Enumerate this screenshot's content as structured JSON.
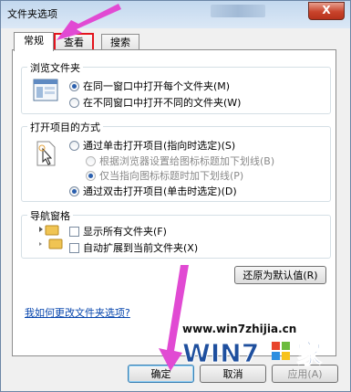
{
  "window": {
    "title": "文件夹选项",
    "close_label": "X"
  },
  "tabs": [
    {
      "label": "常规"
    },
    {
      "label": "查看"
    },
    {
      "label": "搜索"
    }
  ],
  "browse_group": {
    "title": "浏览文件夹",
    "options": [
      {
        "label": "在同一窗口中打开每个文件夹(M)",
        "selected": true
      },
      {
        "label": "在不同窗口中打开不同的文件夹(W)",
        "selected": false
      }
    ]
  },
  "click_group": {
    "title": "打开项目的方式",
    "options": [
      {
        "label": "通过单击打开项目(指向时选定)(S)",
        "selected": false
      },
      {
        "label": "根据浏览器设置给图标标题加下划线(B)",
        "selected": false,
        "disabled": true
      },
      {
        "label": "仅当指向图标标题时加下划线(P)",
        "selected": true,
        "disabled": true
      },
      {
        "label": "通过双击打开项目(单击时选定)(D)",
        "selected": true
      }
    ]
  },
  "nav_group": {
    "title": "导航窗格",
    "options": [
      {
        "label": "显示所有文件夹(F)",
        "checked": false
      },
      {
        "label": "自动扩展到当前文件夹(X)",
        "checked": false
      }
    ]
  },
  "restore_button": "还原为默认值(R)",
  "help_link": "我如何更改文件夹选项?",
  "buttons": {
    "ok": "确定",
    "cancel": "取消",
    "apply": "应用(A)"
  },
  "watermark": {
    "url": "www.win7zhijia.cn",
    "logo_text": "WIN7",
    "logo_suffix": "家"
  },
  "colors": {
    "arrow": "#e14ad3",
    "tab_highlight": "#e3141c",
    "link": "#0645ad"
  }
}
